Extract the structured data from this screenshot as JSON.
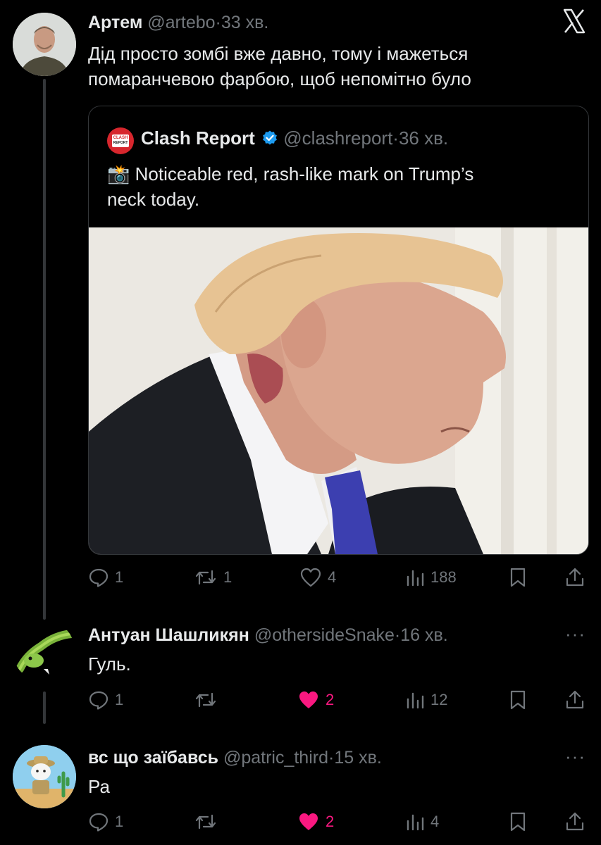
{
  "main_tweet": {
    "author_name": "Артем",
    "handle": "@artebo",
    "separator": "·",
    "time": "33 хв.",
    "text_line1": "Дід просто зомбі вже давно, тому і мажеться",
    "text_line2": "помаранчевою фарбою, щоб непомітно було",
    "stats": {
      "replies": "1",
      "retweets": "1",
      "likes": "4",
      "views": "188"
    }
  },
  "quote": {
    "logo_text_top": "CLASH",
    "logo_text_bottom": "REPORT",
    "author_name": "Clash Report",
    "handle": "@clashreport",
    "separator": "·",
    "time": "36 хв.",
    "emoji": "📸",
    "text_line1": "Noticeable red, rash-like mark on Trump’s",
    "text_line2": "neck today."
  },
  "replies": [
    {
      "author_name": "Антуан Шашликян",
      "handle": "@othersideSnake",
      "separator": "·",
      "time": "16 хв.",
      "text": "Гуль.",
      "stats": {
        "replies": "1",
        "retweets": "",
        "likes": "2",
        "views": "12"
      },
      "liked": true
    },
    {
      "author_name": "вс що заїбавсь",
      "handle": "@patric_third",
      "separator": "·",
      "time": "15 хв.",
      "text": "Ра",
      "stats": {
        "replies": "1",
        "retweets": "",
        "likes": "2",
        "views": "4"
      },
      "liked": true
    }
  ],
  "more_glyph": "···",
  "colors": {
    "background": "#000000",
    "text": "#e7e9ea",
    "muted": "#71767b",
    "like": "#f91880",
    "verified": "#1d9bf0",
    "clash_red": "#d7262d"
  },
  "icons": [
    "x-logo-icon",
    "reply-icon",
    "retweet-icon",
    "like-icon",
    "views-icon",
    "bookmark-icon",
    "share-icon",
    "verified-badge-icon",
    "more-icon"
  ]
}
